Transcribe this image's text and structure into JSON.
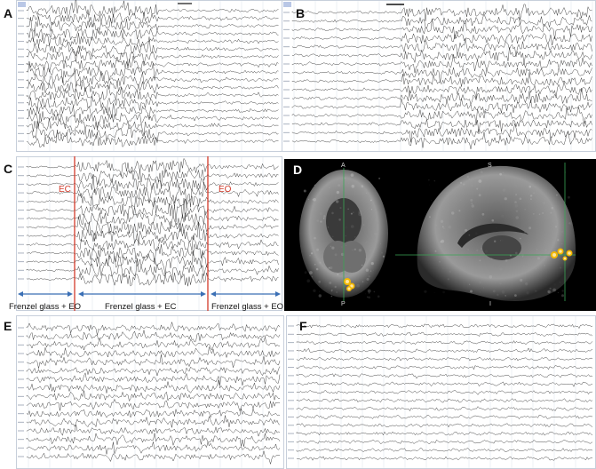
{
  "panels": {
    "A": {
      "label": "A"
    },
    "B": {
      "label": "B"
    },
    "C": {
      "label": "C",
      "events": [
        "EC",
        "EO"
      ],
      "segments": [
        "Frenzel glass + EO",
        "Frenzel glass + EC",
        "Frenzel glass + EO"
      ]
    },
    "D": {
      "label": "D",
      "axial_labels": {
        "top": "A",
        "bottom": "P"
      },
      "sagittal_labels": {
        "top": "S",
        "bottom": "I"
      }
    },
    "E": {
      "label": "E"
    },
    "F": {
      "label": "F"
    }
  },
  "colors": {
    "grid": "#dde3ec",
    "trace": "#333333",
    "event_line": "#d23a2a",
    "arrow": "#3a6fb5",
    "mri_bg": "#000000",
    "activation": "#f5b800",
    "crosshair": "#3aa655"
  }
}
